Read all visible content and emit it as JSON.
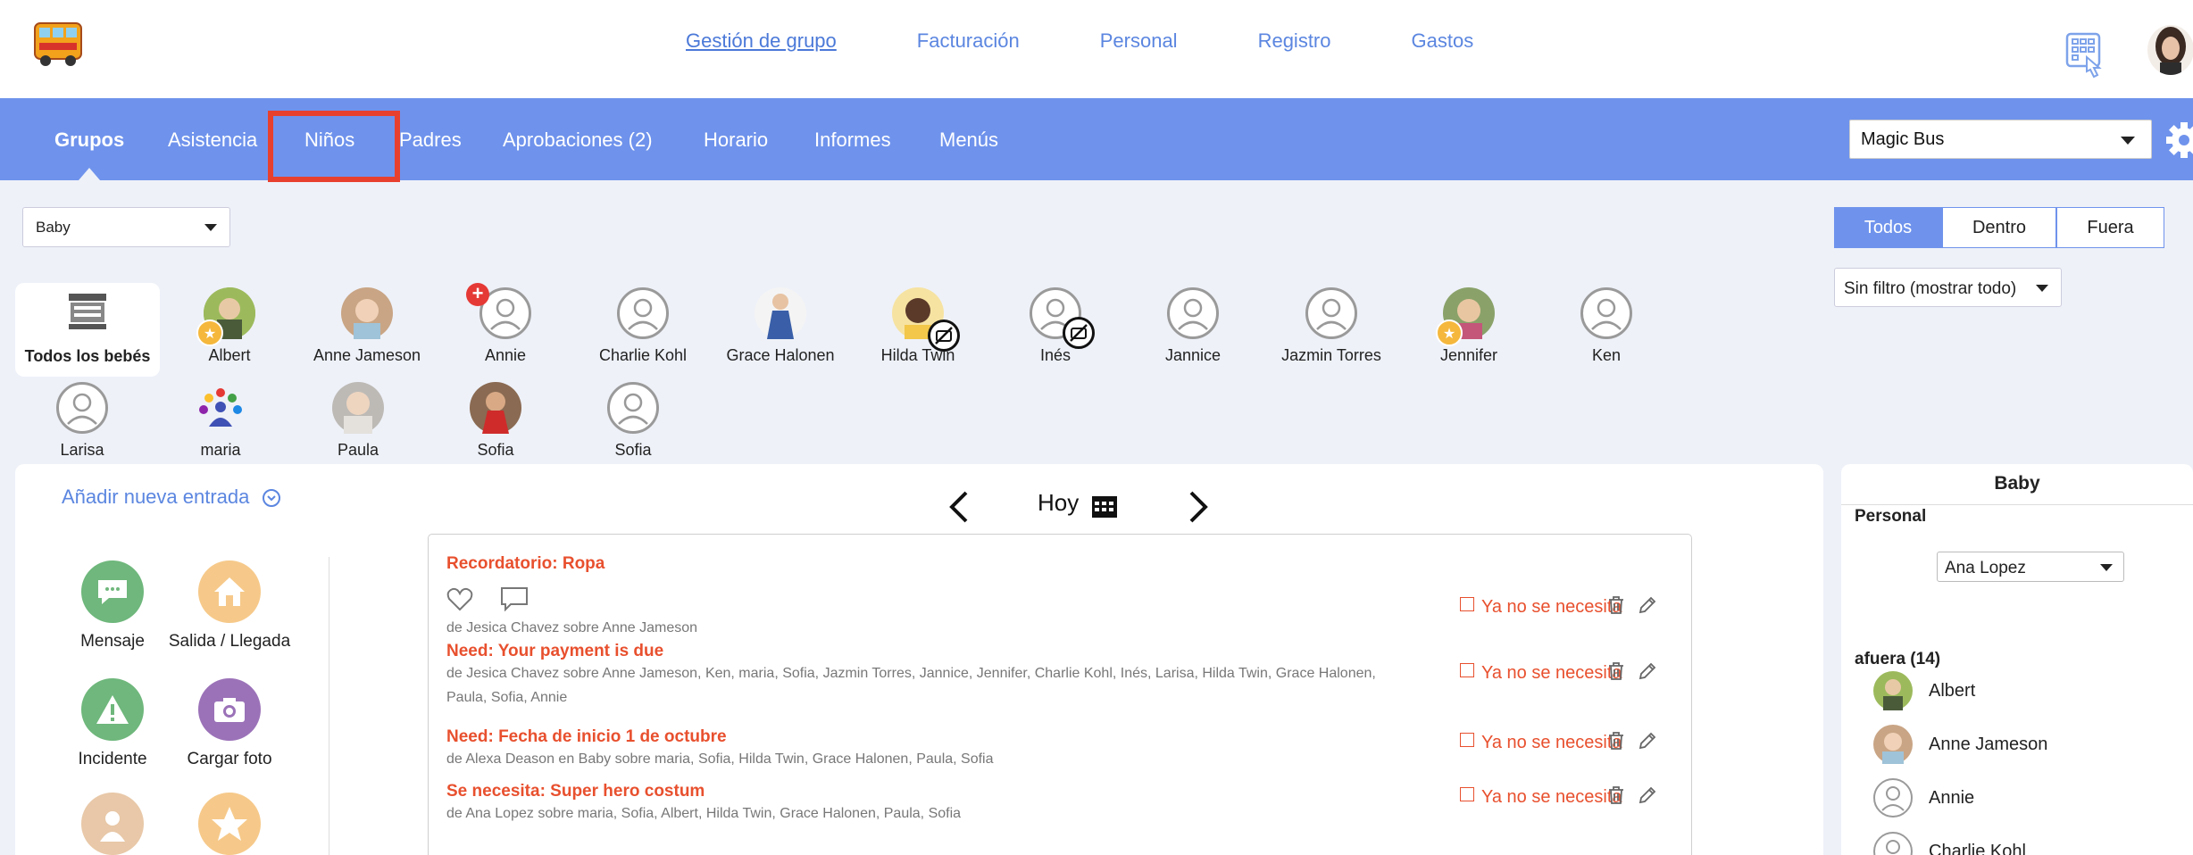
{
  "topnav": {
    "links": [
      "Gestión de grupo",
      "Facturación",
      "Personal",
      "Registro",
      "Gastos"
    ]
  },
  "navbar": {
    "items": [
      "Grupos",
      "Asistencia",
      "Niños",
      "Padres",
      "Aprobaciones (2)",
      "Horario",
      "Informes",
      "Menús"
    ],
    "active": "Grupos",
    "highlighted": "Niños",
    "school_select": "Magic Bus"
  },
  "controls": {
    "group_select": "Baby",
    "segments": [
      "Todos",
      "Dentro",
      "Fuera"
    ],
    "segment_active": "Todos",
    "filter_select": "Sin filtro (mostrar todo)"
  },
  "children": {
    "all_label": "Todos los bebés",
    "items": [
      {
        "name": "Albert"
      },
      {
        "name": "Anne Jameson"
      },
      {
        "name": "Annie"
      },
      {
        "name": "Charlie Kohl"
      },
      {
        "name": "Grace Halonen"
      },
      {
        "name": "Hilda Twin"
      },
      {
        "name": "Inés"
      },
      {
        "name": "Jannice"
      },
      {
        "name": "Jazmin Torres"
      },
      {
        "name": "Jennifer"
      },
      {
        "name": "Ken"
      },
      {
        "name": "Larisa"
      },
      {
        "name": "maria"
      },
      {
        "name": "Paula"
      },
      {
        "name": "Sofia"
      },
      {
        "name": "Sofia"
      }
    ]
  },
  "main": {
    "add_entry": "Añadir nueva entrada",
    "date_label": "Hoy",
    "actions": [
      "Mensaje",
      "Salida / Llegada",
      "Incidente",
      "Cargar foto"
    ],
    "notes": [
      {
        "title": "Recordatorio: Ropa",
        "by": "de Jesica Chavez sobre Anne Jameson",
        "status": "Ya no se necesita"
      },
      {
        "title": "Need: Your payment is due",
        "by": "de Jesica Chavez sobre Anne Jameson, Ken, maria, Sofia, Jazmin Torres, Jannice, Jennifer, Charlie Kohl, Inés, Larisa, Hilda Twin, Grace Halonen, Paula, Sofia, Annie",
        "status": "Ya no se necesita"
      },
      {
        "title": "Need: Fecha de inicio 1 de octubre",
        "by": "de Alexa Deason en Baby sobre maria, Sofia, Hilda Twin, Grace Halonen, Paula, Sofia",
        "status": "Ya no se necesita"
      },
      {
        "title": "Se necesita: Super hero costum",
        "by": "de Ana Lopez sobre maria, Sofia, Albert, Hilda Twin, Grace Halonen, Paula, Sofia",
        "status": "Ya no se necesita"
      }
    ]
  },
  "rightpanel": {
    "title": "Baby",
    "personal_label": "Personal",
    "personal_select": "Ana Lopez",
    "afuera_label": "afuera (14)",
    "list": [
      "Albert",
      "Anne Jameson",
      "Annie",
      "Charlie Kohl"
    ]
  }
}
